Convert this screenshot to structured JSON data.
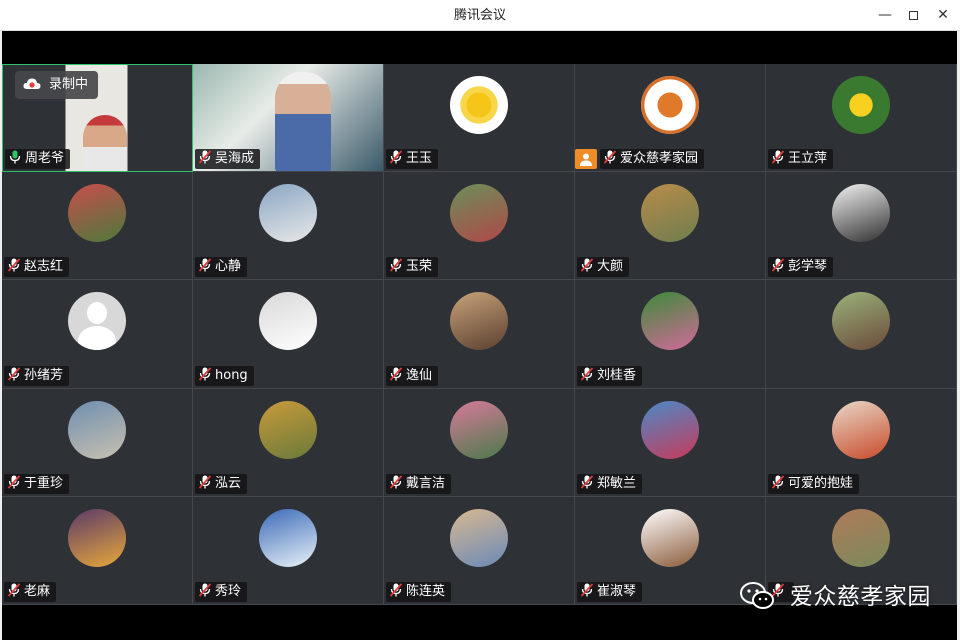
{
  "window": {
    "title": "腾讯会议",
    "minimize_glyph": "—",
    "close_glyph": "✕"
  },
  "recording": {
    "label": "录制中"
  },
  "watermark": {
    "text": "爱众慈孝家园"
  },
  "colors": {
    "speaking_border": "#2fc26a",
    "host_badge": "#f08b2a",
    "mic_muted": "#e23b3b",
    "mic_active": "#2fc26a"
  },
  "participants": [
    {
      "name": "周老爷",
      "mic": "active",
      "video": true,
      "speaking": true,
      "recording": true
    },
    {
      "name": "吴海成",
      "mic": "muted",
      "video": true
    },
    {
      "name": "王玉",
      "mic": "muted",
      "avatar_icon": "sun-icon"
    },
    {
      "name": "爱众慈孝家园",
      "mic": "muted",
      "avatar_icon": "logo-icon",
      "host": true
    },
    {
      "name": "王立萍",
      "mic": "muted",
      "avatar_icon": "flower-icon"
    },
    {
      "name": "赵志红",
      "mic": "muted",
      "avatar_icon": "photo-icon"
    },
    {
      "name": "心静",
      "mic": "muted",
      "avatar_icon": "photo-icon"
    },
    {
      "name": "玉荣",
      "mic": "muted",
      "avatar_icon": "photo-icon"
    },
    {
      "name": "大颜",
      "mic": "muted",
      "avatar_icon": "photo-icon"
    },
    {
      "name": "彭学琴",
      "mic": "muted",
      "avatar_icon": "photo-icon"
    },
    {
      "name": "孙绪芳",
      "mic": "muted",
      "avatar_icon": "default-avatar-icon"
    },
    {
      "name": "hong",
      "mic": "muted",
      "avatar_icon": "photo-icon"
    },
    {
      "name": "逸仙",
      "mic": "muted",
      "avatar_icon": "photo-icon"
    },
    {
      "name": "刘桂香",
      "mic": "muted",
      "avatar_icon": "photo-icon"
    },
    {
      "name": "",
      "mic": "none",
      "avatar_icon": "photo-icon"
    },
    {
      "name": "于重珍",
      "mic": "muted",
      "avatar_icon": "photo-icon"
    },
    {
      "name": "泓云",
      "mic": "muted",
      "avatar_icon": "photo-icon"
    },
    {
      "name": "戴言洁",
      "mic": "muted",
      "avatar_icon": "photo-icon"
    },
    {
      "name": "郑敏兰",
      "mic": "muted",
      "avatar_icon": "photo-icon"
    },
    {
      "name": "可爱的抱娃",
      "mic": "muted",
      "avatar_icon": "photo-icon"
    },
    {
      "name": "老麻",
      "mic": "muted",
      "avatar_icon": "photo-icon"
    },
    {
      "name": "秀玲",
      "mic": "muted",
      "avatar_icon": "photo-icon"
    },
    {
      "name": "陈连英",
      "mic": "muted",
      "avatar_icon": "photo-icon"
    },
    {
      "name": "崔淑琴",
      "mic": "muted",
      "avatar_icon": "photo-icon"
    },
    {
      "name": "",
      "mic": "muted",
      "avatar_icon": "photo-icon"
    }
  ]
}
